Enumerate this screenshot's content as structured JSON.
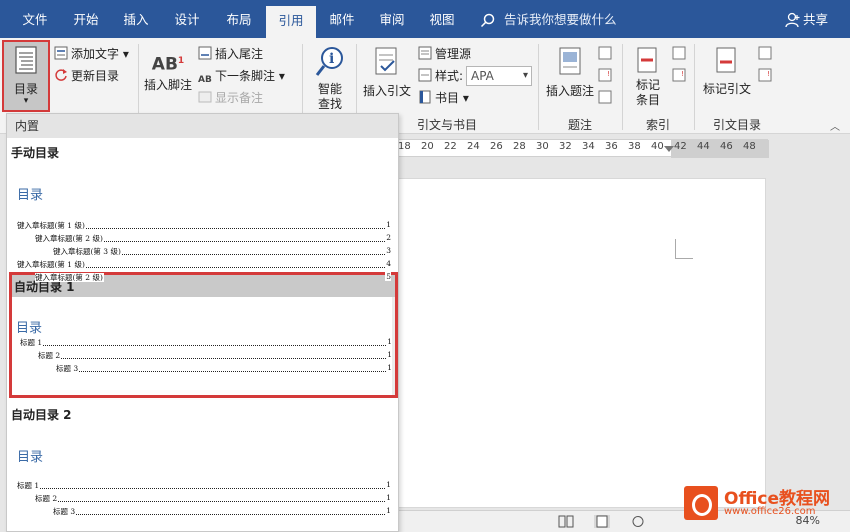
{
  "tabs": [
    "文件",
    "开始",
    "插入",
    "设计",
    "布局",
    "引用",
    "邮件",
    "审阅",
    "视图"
  ],
  "tell_me": "告诉我你想要做什么",
  "share": "共享",
  "ribbon": {
    "toc_button": "目录",
    "add_text": "添加文字",
    "update_toc": "更新目录",
    "insert_footnote": "插入脚注",
    "insert_endnote": "插入尾注",
    "next_footnote": "下一条脚注",
    "show_notes": "显示备注",
    "smart_lookup_1": "智能",
    "smart_lookup_2": "查找",
    "insert_citation": "插入引文",
    "manage_sources": "管理源",
    "style_label": "样式:",
    "style_value": "APA",
    "bibliography": "书目",
    "insert_caption": "插入题注",
    "mark_entry_1": "标记",
    "mark_entry_2": "条目",
    "mark_citation": "标记引文",
    "group_citations": "引文与书目",
    "group_captions": "题注",
    "group_index": "索引",
    "group_toa": "引文目录"
  },
  "ruler_numbers": [
    "18",
    "20",
    "22",
    "24",
    "26",
    "28",
    "30",
    "32",
    "34",
    "36",
    "38",
    "40",
    "42",
    "44",
    "46",
    "48"
  ],
  "panel": {
    "header": "内置",
    "manual": {
      "title": "手动目录",
      "heading": "目录",
      "lines": [
        {
          "text": "键入章标题(第 1 级)",
          "page": "1"
        },
        {
          "text": "键入章标题(第 2 级)",
          "page": "2"
        },
        {
          "text": "键入章标题(第 3 级)",
          "page": "3"
        },
        {
          "text": "键入章标题(第 1 级)",
          "page": "4"
        },
        {
          "text": "键入章标题(第 2 级)",
          "page": "5"
        }
      ]
    },
    "auto1": {
      "title": "自动目录 1",
      "heading": "目录",
      "lines": [
        {
          "text": "标题 1",
          "page": "1"
        },
        {
          "text": "标题 2",
          "page": "1"
        },
        {
          "text": "标题 3",
          "page": "1"
        }
      ]
    },
    "auto2": {
      "title": "自动目录 2",
      "heading": "目录",
      "lines": [
        {
          "text": "标题 1",
          "page": "1"
        },
        {
          "text": "标题 2",
          "page": "1"
        },
        {
          "text": "标题 3",
          "page": "1"
        }
      ]
    }
  },
  "zoom": "84%",
  "watermark": {
    "name": "Office教程网",
    "url": "www.office26.com"
  },
  "colors": {
    "accent": "#2b579a",
    "highlight": "#d43a3a",
    "toc_heading": "#3a6aa6"
  }
}
